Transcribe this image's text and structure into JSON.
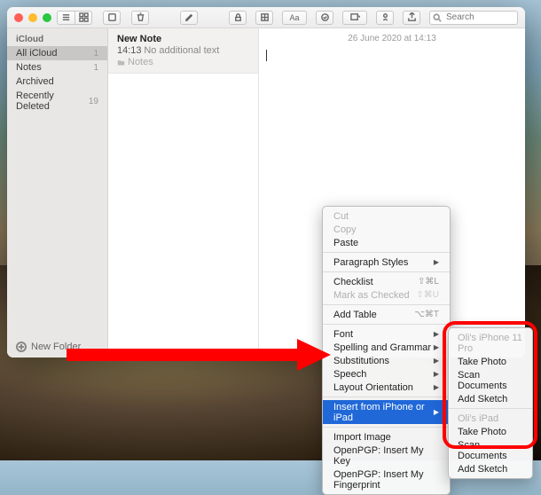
{
  "toolbar": {
    "search_ph": "Search"
  },
  "sidebar": {
    "section": "iCloud",
    "items": [
      {
        "label": "All iCloud",
        "count": "1"
      },
      {
        "label": "Notes",
        "count": "1"
      },
      {
        "label": "Archived",
        "count": " "
      },
      {
        "label": "Recently Deleted",
        "count": "19"
      }
    ],
    "new_folder": "New Folder"
  },
  "list": {
    "title": "New Note",
    "time": "14:13",
    "sub": "No additional text",
    "folder": "Notes"
  },
  "editor": {
    "date": "26 June 2020 at 14:13"
  },
  "ctx": {
    "cut": "Cut",
    "copy": "Copy",
    "paste": "Paste",
    "para": "Paragraph Styles",
    "check": "Checklist",
    "check_sc": "⇧⌘L",
    "mark": "Mark as Checked",
    "mark_sc": "⇧⌘U",
    "table": "Add Table",
    "table_sc": "⌥⌘T",
    "font": "Font",
    "spell": "Spelling and Grammar",
    "subs": "Substitutions",
    "speech": "Speech",
    "layout": "Layout Orientation",
    "insert": "Insert from iPhone or iPad",
    "import": "Import Image",
    "pgp1": "OpenPGP: Insert My Key",
    "pgp2": "OpenPGP: Insert My Fingerprint"
  },
  "sub": {
    "d1": "Oli's iPhone 11 Pro",
    "p1": "Take Photo",
    "p2": "Scan Documents",
    "p3": "Add Sketch",
    "d2": "Oli's iPad",
    "q1": "Take Photo",
    "q2": "Scan Documents",
    "q3": "Add Sketch"
  }
}
